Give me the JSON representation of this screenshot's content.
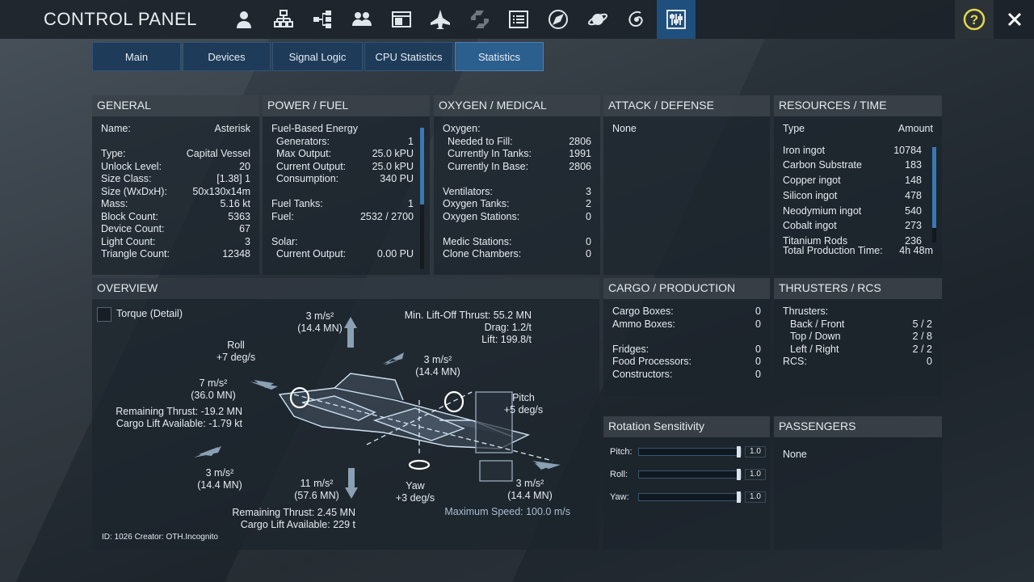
{
  "header": {
    "title": "CONTROL PANEL",
    "icons": [
      "player-icon",
      "structure-icon",
      "network-icon",
      "faction-icon",
      "browser-icon",
      "ship-icon",
      "blueprint-icon",
      "list-icon",
      "compass-icon",
      "planet-icon",
      "galaxy-icon",
      "control-panel-icon"
    ],
    "active_icon": "control-panel-icon"
  },
  "tabs": [
    {
      "label": "Main"
    },
    {
      "label": "Devices"
    },
    {
      "label": "Signal Logic"
    },
    {
      "label": "CPU Statistics"
    },
    {
      "label": "Statistics"
    }
  ],
  "general": {
    "title": "GENERAL",
    "rows": [
      {
        "k": "Name:",
        "v": "Asterisk"
      },
      {
        "k": "Type:",
        "v": "Capital Vessel"
      },
      {
        "k": "Unlock Level:",
        "v": "20"
      },
      {
        "k": "Size Class:",
        "v": "[1.38]   1"
      },
      {
        "k": "Size (WxDxH):",
        "v": "50x130x14m"
      },
      {
        "k": "Mass:",
        "v": "5.16 kt"
      },
      {
        "k": "Block Count:",
        "v": "5363"
      },
      {
        "k": "Device Count:",
        "v": "67"
      },
      {
        "k": "Light Count:",
        "v": "3"
      },
      {
        "k": "Triangle Count:",
        "v": "12348"
      }
    ]
  },
  "power": {
    "title": "POWER / FUEL",
    "fuel_energy": "Fuel-Based Energy",
    "rows1": [
      {
        "k": "Generators:",
        "v": "1"
      },
      {
        "k": "Max Output:",
        "v": "25.0 kPU"
      },
      {
        "k": "Current Output:",
        "v": "25.0 kPU"
      },
      {
        "k": "Consumption:",
        "v": "340 PU"
      }
    ],
    "fuel_tanks": {
      "k": "Fuel Tanks:",
      "v": "1"
    },
    "fuel": {
      "k": "Fuel:",
      "v": "2532 / 2700"
    },
    "solar": "Solar:",
    "solar_output": {
      "k": "Current Output:",
      "v": "0.00 PU"
    }
  },
  "oxygen": {
    "title": "OXYGEN / MEDICAL",
    "oxygen_label": "Oxygen:",
    "rows1": [
      {
        "k": "Needed to Fill:",
        "v": "2806"
      },
      {
        "k": "Currently In Tanks:",
        "v": "1991"
      },
      {
        "k": "Currently In Base:",
        "v": "2806"
      }
    ],
    "rows2": [
      {
        "k": "Ventilators:",
        "v": "3"
      },
      {
        "k": "Oxygen Tanks:",
        "v": "2"
      },
      {
        "k": "Oxygen Stations:",
        "v": "0"
      }
    ],
    "rows3": [
      {
        "k": "Medic Stations:",
        "v": "0"
      },
      {
        "k": "Clone Chambers:",
        "v": "0"
      }
    ]
  },
  "attack": {
    "title": "ATTACK / DEFENSE",
    "value": "None"
  },
  "resources": {
    "title": "RESOURCES / TIME",
    "col_type": "Type",
    "col_amount": "Amount",
    "rows": [
      {
        "k": "Iron ingot",
        "v": "10784"
      },
      {
        "k": "Carbon Substrate",
        "v": "183"
      },
      {
        "k": "Copper ingot",
        "v": "148"
      },
      {
        "k": "Silicon ingot",
        "v": "478"
      },
      {
        "k": "Neodymium ingot",
        "v": "540"
      },
      {
        "k": "Cobalt ingot",
        "v": "273"
      },
      {
        "k": "Titanium Rods",
        "v": "236"
      }
    ],
    "total": {
      "k": "Total Production Time:",
      "v": "4h 48m"
    }
  },
  "overview": {
    "title": "OVERVIEW",
    "torque_label": "Torque (Detail)",
    "up": {
      "accel": "3 m/s²",
      "thrust": "(14.4 MN)"
    },
    "lift": [
      "Min. Lift-Off Thrust: 55.2 MN",
      "Drag: 1.2/t",
      "Lift: 199.8/t"
    ],
    "roll": {
      "label": "Roll",
      "value": "+7 deg/s"
    },
    "forward_up": {
      "accel": "3 m/s²",
      "thrust": "(14.4 MN)"
    },
    "left": {
      "accel": "7 m/s²",
      "thrust": "(36.0 MN)"
    },
    "left_remaining": "Remaining Thrust: -19.2 MN",
    "left_cargo": "Cargo Lift Available: -1.79 kt",
    "pitch": {
      "label": "Pitch",
      "value": "+5 deg/s"
    },
    "back_left": {
      "accel": "3 m/s²",
      "thrust": "(14.4 MN)"
    },
    "down": {
      "accel": "11 m/s²",
      "thrust": "(57.6 MN)"
    },
    "yaw": {
      "label": "Yaw",
      "value": "+3 deg/s"
    },
    "forward": {
      "accel": "3 m/s²",
      "thrust": "(14.4 MN)"
    },
    "down_remaining": "Remaining Thrust: 2.45 MN",
    "down_cargo": "Cargo Lift Available: 229 t",
    "max_speed": "Maximum Speed: 100.0 m/s",
    "footer": "ID: 1026  Creator: OTH.Incognito"
  },
  "cargo": {
    "title": "CARGO / PRODUCTION",
    "rows1": [
      {
        "k": "Cargo Boxes:",
        "v": "0"
      },
      {
        "k": "Ammo Boxes:",
        "v": "0"
      }
    ],
    "rows2": [
      {
        "k": "Fridges:",
        "v": "0"
      },
      {
        "k": "Food Processors:",
        "v": "0"
      },
      {
        "k": "Constructors:",
        "v": "0"
      }
    ]
  },
  "thrusters": {
    "title": "THRUSTERS / RCS",
    "label": "Thrusters:",
    "rows": [
      {
        "k": "Back / Front",
        "v": "5 / 2"
      },
      {
        "k": "Top / Down",
        "v": "2 / 8"
      },
      {
        "k": "Left / Right",
        "v": "2 / 2"
      }
    ],
    "rcs": {
      "k": "RCS:",
      "v": "0"
    }
  },
  "sensitivity": {
    "title": "Rotation Sensitivity",
    "rows": [
      {
        "label": "Pitch:",
        "value": "1.0",
        "level": 1.0
      },
      {
        "label": "Roll:",
        "value": "1.0",
        "level": 1.0
      },
      {
        "label": "Yaw:",
        "value": "1.0",
        "level": 1.0
      }
    ]
  },
  "passengers": {
    "title": "PASSENGERS",
    "value": "None"
  }
}
